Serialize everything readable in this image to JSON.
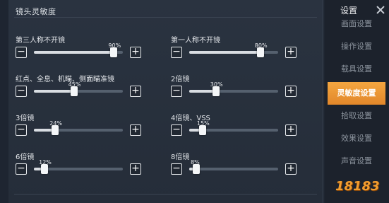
{
  "panel": {
    "section_title": "镜头灵敏度",
    "settings": [
      {
        "label": "第三人称不开镜",
        "percent_label": "90%",
        "value": 0.9
      },
      {
        "label": "第一人称不开镜",
        "percent_label": "80%",
        "value": 0.8
      },
      {
        "label": "红点、全息、机瞄、侧面瞄准镜",
        "percent_label": "45%",
        "value": 0.45
      },
      {
        "label": "2倍镜",
        "percent_label": "30%",
        "value": 0.3
      },
      {
        "label": "3倍镜",
        "percent_label": "24%",
        "value": 0.24
      },
      {
        "label": "4倍镜、VSS",
        "percent_label": "15%",
        "value": 0.15
      },
      {
        "label": "6倍镜",
        "percent_label": "12%",
        "value": 0.12
      },
      {
        "label": "8倍镜",
        "percent_label": "8%",
        "value": 0.08
      }
    ],
    "minus_symbol": "−",
    "plus_symbol": "+"
  },
  "sidebar": {
    "title": "设置",
    "items": [
      {
        "label": "画面设置",
        "active": false
      },
      {
        "label": "操作设置",
        "active": false
      },
      {
        "label": "载具设置",
        "active": false
      },
      {
        "label": "灵敏度设置",
        "active": true
      },
      {
        "label": "拾取设置",
        "active": false
      },
      {
        "label": "效果设置",
        "active": false
      },
      {
        "label": "声音设置",
        "active": false
      }
    ]
  },
  "watermark": "18183",
  "colors": {
    "accent": "#f0a03a",
    "panel_bg": "#252d39",
    "sidebar_bg": "#1c222c"
  }
}
